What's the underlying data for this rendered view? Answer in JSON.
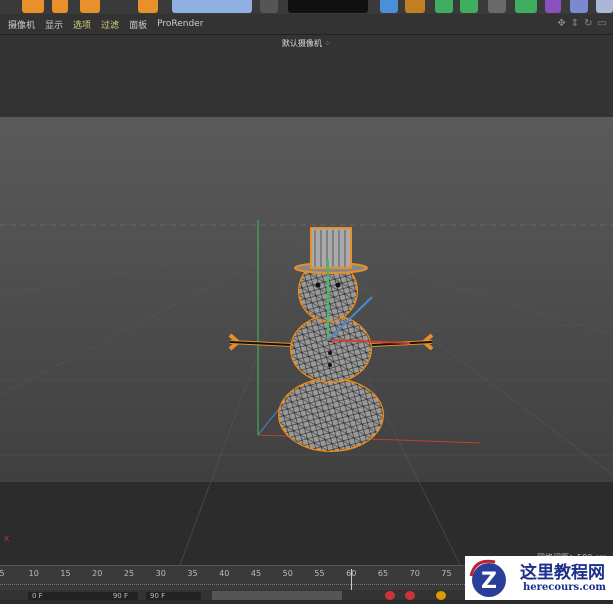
{
  "menu": {
    "items": [
      "摄像机",
      "显示",
      "选项",
      "过滤",
      "面板",
      "ProRender"
    ]
  },
  "viewport": {
    "camera_label": "默认摄像机",
    "grid_spacing": "网格间距：500 cm",
    "axis_x_label": "x"
  },
  "timeline": {
    "ticks": [
      "5",
      "10",
      "15",
      "20",
      "25",
      "30",
      "35",
      "40",
      "45",
      "50",
      "55",
      "60",
      "65",
      "70",
      "75"
    ],
    "playhead_frame": "60"
  },
  "controls": {
    "start_frame": "0 F",
    "end_frame": "90 F",
    "max_frame": "90 F"
  },
  "watermark": {
    "title": "这里教程网",
    "url": "herecours.com"
  },
  "colors": {
    "accent_orange": "#e8902a",
    "selection_outline": "#e8902a",
    "y_axis": "#3fbf5f",
    "x_axis": "#d04030",
    "z_axis": "#4a8ad0"
  }
}
